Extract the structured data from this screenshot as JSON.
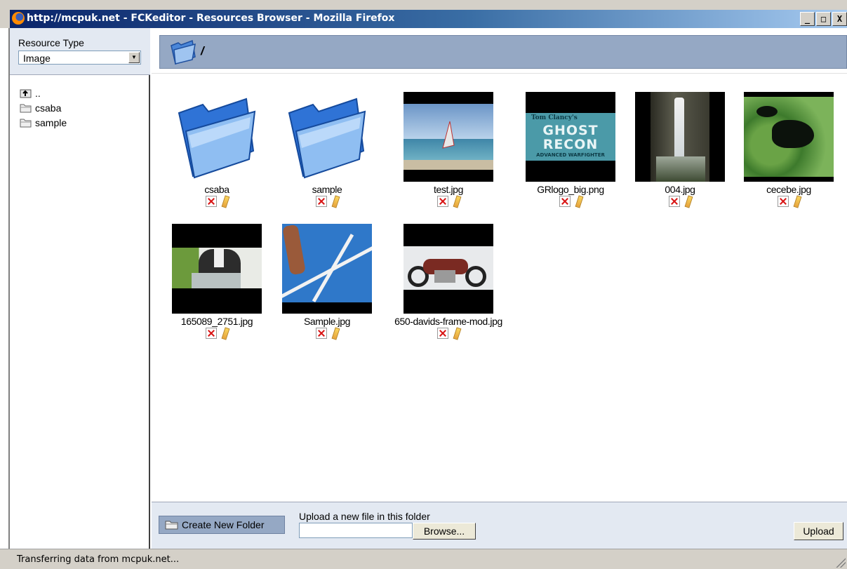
{
  "window": {
    "title": "http://mcpuk.net - FCKeditor - Resources Browser - Mozilla Firefox",
    "controls": [
      "_",
      "□",
      "X"
    ]
  },
  "resource_type": {
    "label": "Resource Type",
    "selected": "Image"
  },
  "tree": [
    {
      "label": "..",
      "icon": "folder-up-icon"
    },
    {
      "label": "csaba",
      "icon": "folder-icon"
    },
    {
      "label": "sample",
      "icon": "folder-icon"
    }
  ],
  "current_path": "/",
  "items": [
    {
      "name": "csaba",
      "kind": "folder"
    },
    {
      "name": "sample",
      "kind": "folder"
    },
    {
      "name": "test.jpg",
      "kind": "image"
    },
    {
      "name": "GRlogo_big.png",
      "kind": "image",
      "logo_text": [
        "Tom Clancy's",
        "GHOST",
        "RECON",
        "ADVANCED WARFIGHTER"
      ]
    },
    {
      "name": "004.jpg",
      "kind": "image"
    },
    {
      "name": "cecebe.jpg",
      "kind": "image"
    },
    {
      "name": "165089_2751.jpg",
      "kind": "image"
    },
    {
      "name": "Sample.jpg",
      "kind": "image"
    },
    {
      "name": "650-davids-frame-mod.jpg",
      "kind": "image"
    }
  ],
  "bottom": {
    "create_folder_label": "Create New Folder",
    "upload_label": "Upload a new file in this folder",
    "browse_label": "Browse...",
    "upload_button": "Upload"
  },
  "status": "Transferring data from mcpuk.net...",
  "colors": {
    "titlebar": "#0a246a",
    "pathbar": "#95a8c4",
    "panel": "#e3e9f2",
    "delete_icon": "#d81515"
  }
}
